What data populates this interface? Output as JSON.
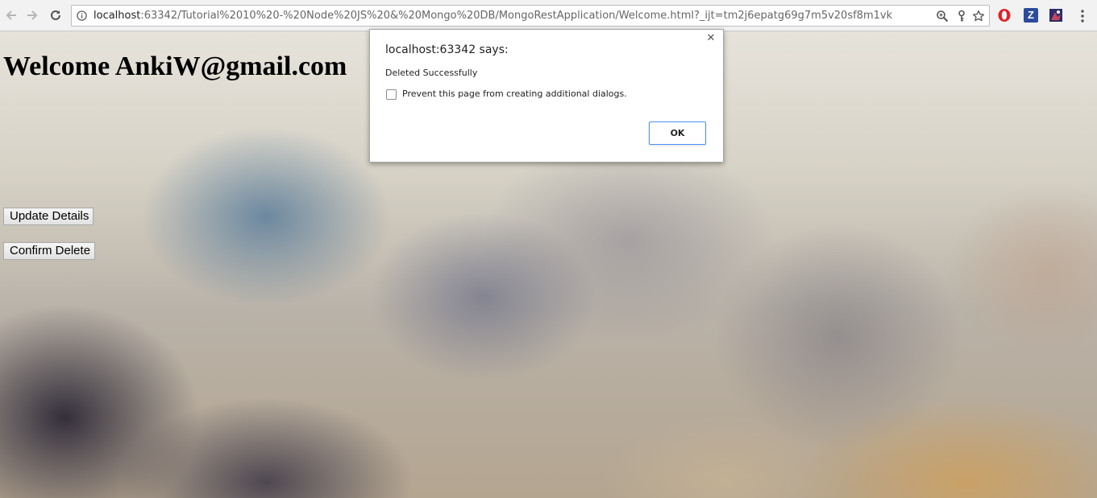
{
  "browser": {
    "url_host": "localhost",
    "url_rest": ":63342/Tutorial%2010%20-%20Node%20JS%20&%20Mongo%20DB/MongoRestApplication/Welcome.html?_ijt=tm2j6epatg69g7m5v20sf8m1vk",
    "extensions": {
      "z_label": "Z"
    },
    "colors": {
      "opera_red": "#e0212b",
      "z_blue": "#2c4b9b"
    }
  },
  "page": {
    "heading": "Welcome AnkiW@gmail.com",
    "update_button": "Update Details",
    "delete_button": "Confirm Delete"
  },
  "dialog": {
    "title": "localhost:63342 says:",
    "message": "Deleted Successfully",
    "checkbox_label": "Prevent this page from creating additional dialogs.",
    "ok_label": "OK",
    "close_glyph": "✕",
    "accent": "#4d90fe"
  }
}
